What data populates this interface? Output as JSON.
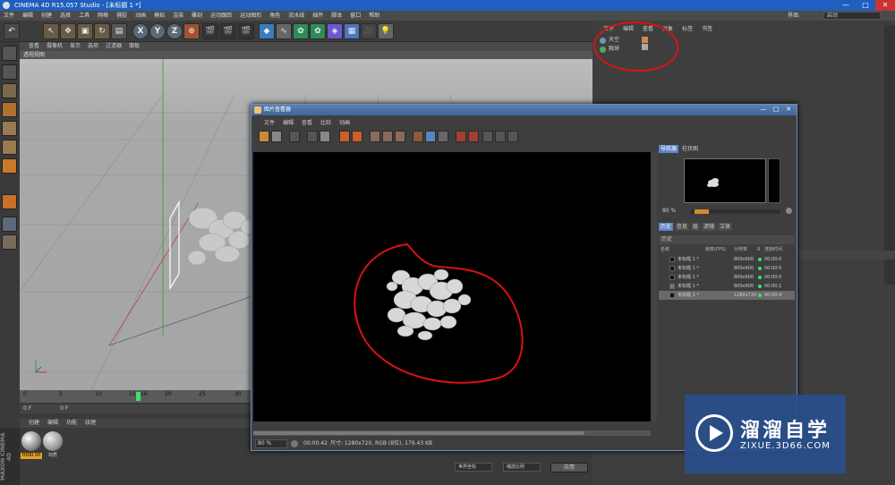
{
  "window": {
    "title": "CINEMA 4D R15.057 Studio - [未标题 1 *]",
    "controls": [
      "—",
      "□",
      "✕"
    ]
  },
  "menubar": [
    "文件",
    "编辑",
    "创建",
    "选择",
    "工具",
    "网格",
    "捕捉",
    "动画",
    "模拟",
    "渲染",
    "雕刻",
    "运动跟踪",
    "运动图形",
    "角色",
    "流水线",
    "插件",
    "脚本",
    "窗口",
    "帮助"
  ],
  "layout": {
    "label": "界面:",
    "value": "启动"
  },
  "toolbar": {
    "axis_x": "X",
    "axis_y": "Y",
    "axis_z": "Z"
  },
  "viewport": {
    "menu": [
      "查看",
      "摄像机",
      "显示",
      "选项",
      "过滤器",
      "面板"
    ],
    "title": "透视视图"
  },
  "timeline": {
    "ticks": [
      "0",
      "5",
      "10",
      "15",
      "16",
      "20",
      "25",
      "30"
    ],
    "current_frame": "0 F",
    "frame_field": "0 F"
  },
  "materials": {
    "menu": [
      "创建",
      "编辑",
      "功能",
      "纹理"
    ],
    "items": [
      {
        "label": "HDRI 00"
      },
      {
        "label": "材质"
      }
    ],
    "brand": "MAXON CINEMA 4D"
  },
  "object_manager": {
    "menu": [
      "文件",
      "编辑",
      "查看",
      "对象",
      "标签",
      "书签"
    ],
    "rows": [
      {
        "name": "天空"
      },
      {
        "name": "融球"
      }
    ]
  },
  "coordinates": {
    "field_a": "世界坐标",
    "field_b": "缩放比例",
    "apply": "应用"
  },
  "picture_viewer": {
    "title": "图片查看器",
    "menu": [
      "文件",
      "编辑",
      "查看",
      "比较",
      "动画"
    ],
    "right_tabs": [
      "导航器",
      "柱状图"
    ],
    "nav_zoom": "80 %",
    "history_tabs": [
      "历史",
      "信息",
      "层",
      "滤镜",
      "立体"
    ],
    "history_label": "历史",
    "history_columns": [
      "名称",
      "帧率(FPS)",
      "分辨率",
      "R",
      "渲染时间"
    ],
    "history_rows": [
      {
        "name": "未标题 1 *",
        "res": "800x600",
        "time": "00:00:0"
      },
      {
        "name": "未标题 1 *",
        "res": "800x600",
        "time": "00:00:0"
      },
      {
        "name": "未标题 1 *",
        "res": "800x600",
        "time": "00:00:0"
      },
      {
        "name": "未标题 1 *",
        "res": "800x600",
        "time": "00:00:1"
      },
      {
        "name": "未标题 1 *",
        "res": "1280x720",
        "time": "00:00:4"
      }
    ],
    "status": {
      "zoom": "80 %",
      "render_time": "00:00:42",
      "info": "尺寸: 1280x720, RGB (8位), 179.43 KB"
    }
  },
  "watermark": {
    "title": "溜溜自学",
    "url": "ZIXUE.3D66.COM"
  },
  "colors": {
    "titlebar": "#1f5fbf",
    "annotation": "#dd1111",
    "playhead": "#3de16a",
    "tab_active": "#5b84c2",
    "watermark_bg": "#284e8c"
  }
}
